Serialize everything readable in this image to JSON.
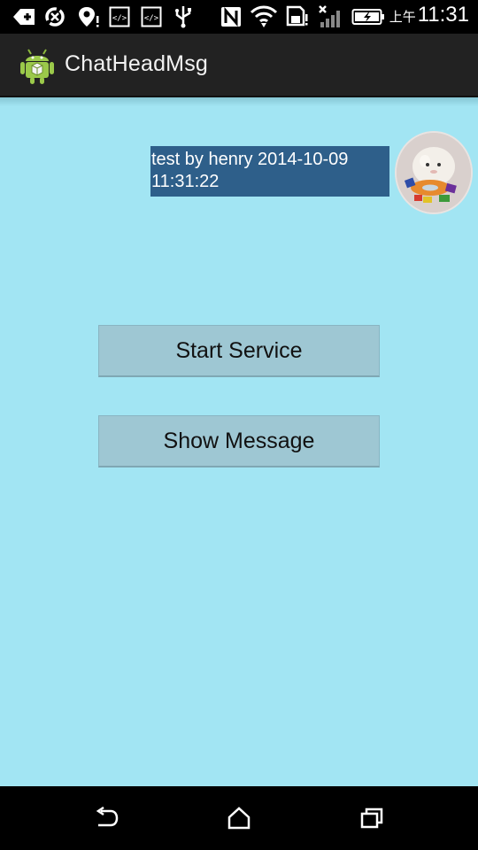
{
  "status_bar": {
    "time_ampm": "上午",
    "time": "11:31",
    "icons": [
      "add-icon",
      "sync-icon",
      "location-icon",
      "code-icon",
      "code-icon",
      "usb-icon",
      "nfc-icon",
      "wifi-icon",
      "sd-card-icon",
      "signal-icon",
      "battery-charging-icon"
    ]
  },
  "action_bar": {
    "title": "ChatHeadMsg",
    "logo": "android-icon"
  },
  "chat_head": {
    "message": "test by henry  2014-10-09 11:31:22",
    "avatar": "hamster-photo"
  },
  "buttons": {
    "start_service": "Start Service",
    "show_message": "Show Message"
  },
  "nav_bar": {
    "icons": [
      "back-icon",
      "home-icon",
      "recents-icon"
    ]
  },
  "colors": {
    "background": "#a2e5f3",
    "bubble": "#2e5f8a",
    "button": "#9ec7d3",
    "action_bar": "#222222"
  }
}
